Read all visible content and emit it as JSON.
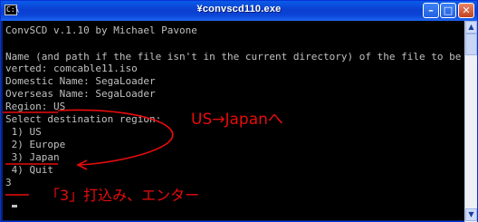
{
  "window": {
    "title": "¥convscd110.exe",
    "icon_label": "C:\\",
    "minimize_glyph": "–",
    "maximize_glyph": "□",
    "close_glyph": "✕"
  },
  "console": {
    "lines": [
      "ConvSCD v.1.10 by Michael Pavone",
      "",
      "Name (and path if the file isn't in the current directory) of the file to be co",
      "verted: comcable11.iso",
      "Domestic Name: SegaLoader",
      "Overseas Name: SegaLoader",
      "Region: US",
      "Select destination region:",
      " 1) US",
      " 2) Europe",
      " 3) Japan",
      " 4) Quit",
      "3"
    ]
  },
  "scrollbar": {
    "up_glyph": "▲",
    "down_glyph": "▼"
  },
  "annotations": {
    "region_note": "US→Japanへ",
    "input_note": "「3」打込み、エンター",
    "color": "#e80c0c"
  }
}
